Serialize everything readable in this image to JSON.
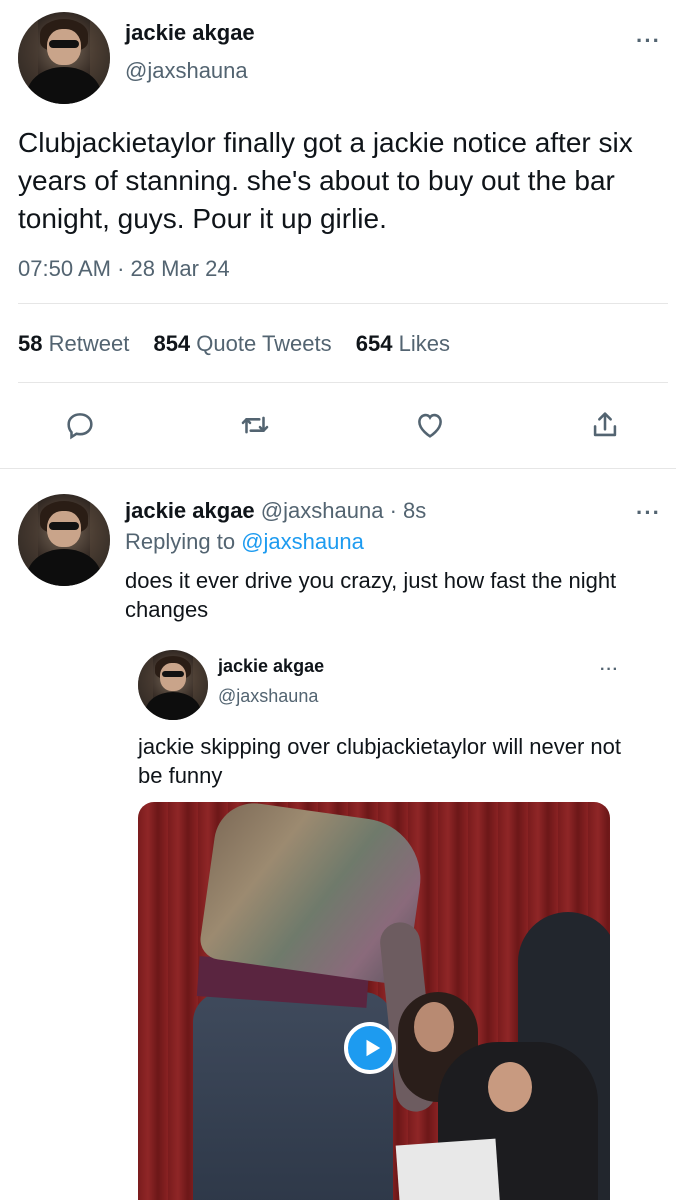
{
  "main_tweet": {
    "author_name": "jackie akgae",
    "author_handle": "@jaxshauna",
    "text": "Clubjackietaylor finally got a jackie notice after six years of stanning. she's about to buy out the bar tonight, guys. Pour it up girlie.",
    "timestamp": "07:50 AM · 28 Mar 24",
    "more_label": "···",
    "stats": [
      {
        "count": "58",
        "label": "Retweet"
      },
      {
        "count": "854",
        "label": "Quote Tweets"
      },
      {
        "count": "654",
        "label": "Likes"
      }
    ],
    "actions": [
      "reply-icon",
      "retweet-icon",
      "like-icon",
      "share-icon"
    ]
  },
  "reply_tweet": {
    "author_name": "jackie akgae",
    "author_handle": "@jaxshauna",
    "time_ago": "· 8s",
    "replying_prefix": "Replying to",
    "replying_to": "@jaxshauna",
    "text": "does it ever drive you crazy, just how fast the night changes",
    "more_label": "···",
    "quoted": {
      "author_name": "jackie akgae",
      "author_handle": "@jaxshauna",
      "text": "jackie skipping over clubjackietaylor will never not be funny",
      "more_label": "···",
      "media": {
        "type": "video",
        "icon": "play-icon",
        "accent": "#1d9bf0"
      }
    }
  },
  "colors": {
    "accent": "#1d9bf0",
    "text": "#0f1419",
    "secondary": "#536471",
    "divider": "#e6e6e6"
  }
}
